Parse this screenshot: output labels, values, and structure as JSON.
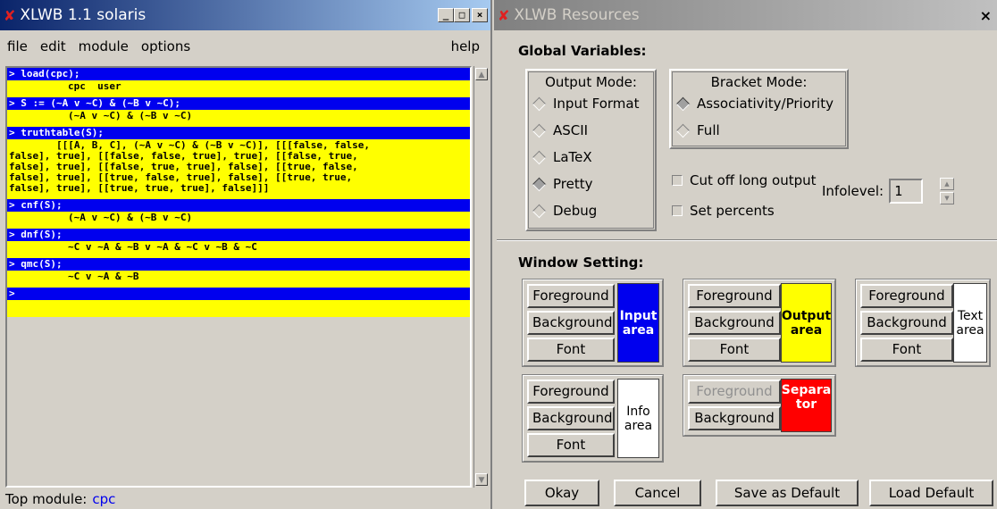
{
  "left_window": {
    "title": "XLWB 1.1 solaris",
    "title_buttons": [
      "_",
      "□",
      "×"
    ],
    "menu": [
      "file",
      "edit",
      "module",
      "options"
    ],
    "menu_help": "help",
    "cells": [
      {
        "input": "> load(cpc);",
        "output": "cpc  user"
      },
      {
        "input": "> S := (~A v ~C) & (~B v ~C);",
        "output": "(~A v ~C) & (~B v ~C)"
      },
      {
        "input": "> truthtable(S);",
        "output": "        [[[A, B, C], (~A v ~C) & (~B v ~C)], [[[false, false,\nfalse], true], [[false, false, true], true], [[false, true,\nfalse], true], [[false, true, true], false], [[true, false,\nfalse], true], [[true, false, true], false], [[true, true,\nfalse], true], [[true, true, true], false]]]"
      },
      {
        "input": "> cnf(S);",
        "output": "(~A v ~C) & (~B v ~C)"
      },
      {
        "input": "> dnf(S);",
        "output": "~C v ~A & ~B v ~A & ~C v ~B & ~C"
      },
      {
        "input": "> qmc(S);",
        "output": "~C v ~A & ~B"
      },
      {
        "input": ">",
        "output": " "
      }
    ],
    "status_label": "Top module:",
    "status_value": "cpc"
  },
  "right_window": {
    "title": "XLWB Resources",
    "close": "×",
    "global_label": "Global Variables:",
    "output_mode": {
      "title": "Output Mode:",
      "options": [
        "Input Format",
        "ASCII",
        "LaTeX",
        "Pretty",
        "Debug"
      ],
      "selected": "Pretty"
    },
    "bracket_mode": {
      "title": "Bracket Mode:",
      "options": [
        "Associativity/Priority",
        "Full"
      ],
      "selected": "Associativity/Priority"
    },
    "cut_off_label": "Cut off long output",
    "set_percents_label": "Set percents",
    "infolevel_label": "Infolevel:",
    "infolevel_value": "1",
    "window_setting_label": "Window Setting:",
    "areas": {
      "input": {
        "fg": "Foreground",
        "bg": "Background",
        "font": "Font",
        "label": "Input area",
        "color": "#0000ee",
        "text_color": "#ffffff"
      },
      "output": {
        "fg": "Foreground",
        "bg": "Background",
        "font": "Font",
        "label": "Output area",
        "color": "#ffff00",
        "text_color": "#000000"
      },
      "text": {
        "fg": "Foreground",
        "bg": "Background",
        "font": "Font",
        "label": "Text area",
        "color": "#ffffff",
        "text_color": "#000000"
      },
      "info": {
        "fg": "Foreground",
        "bg": "Background",
        "font": "Font",
        "label": "Info area",
        "color": "#ffffff",
        "text_color": "#000000"
      },
      "separator": {
        "fg": "Foreground",
        "bg": "Background",
        "label": "Separa tor",
        "color": "#ff0000",
        "text_color": "#ffffff"
      }
    },
    "buttons": {
      "okay": "Okay",
      "cancel": "Cancel",
      "save_default": "Save as Default",
      "load_default": "Load Default"
    }
  }
}
